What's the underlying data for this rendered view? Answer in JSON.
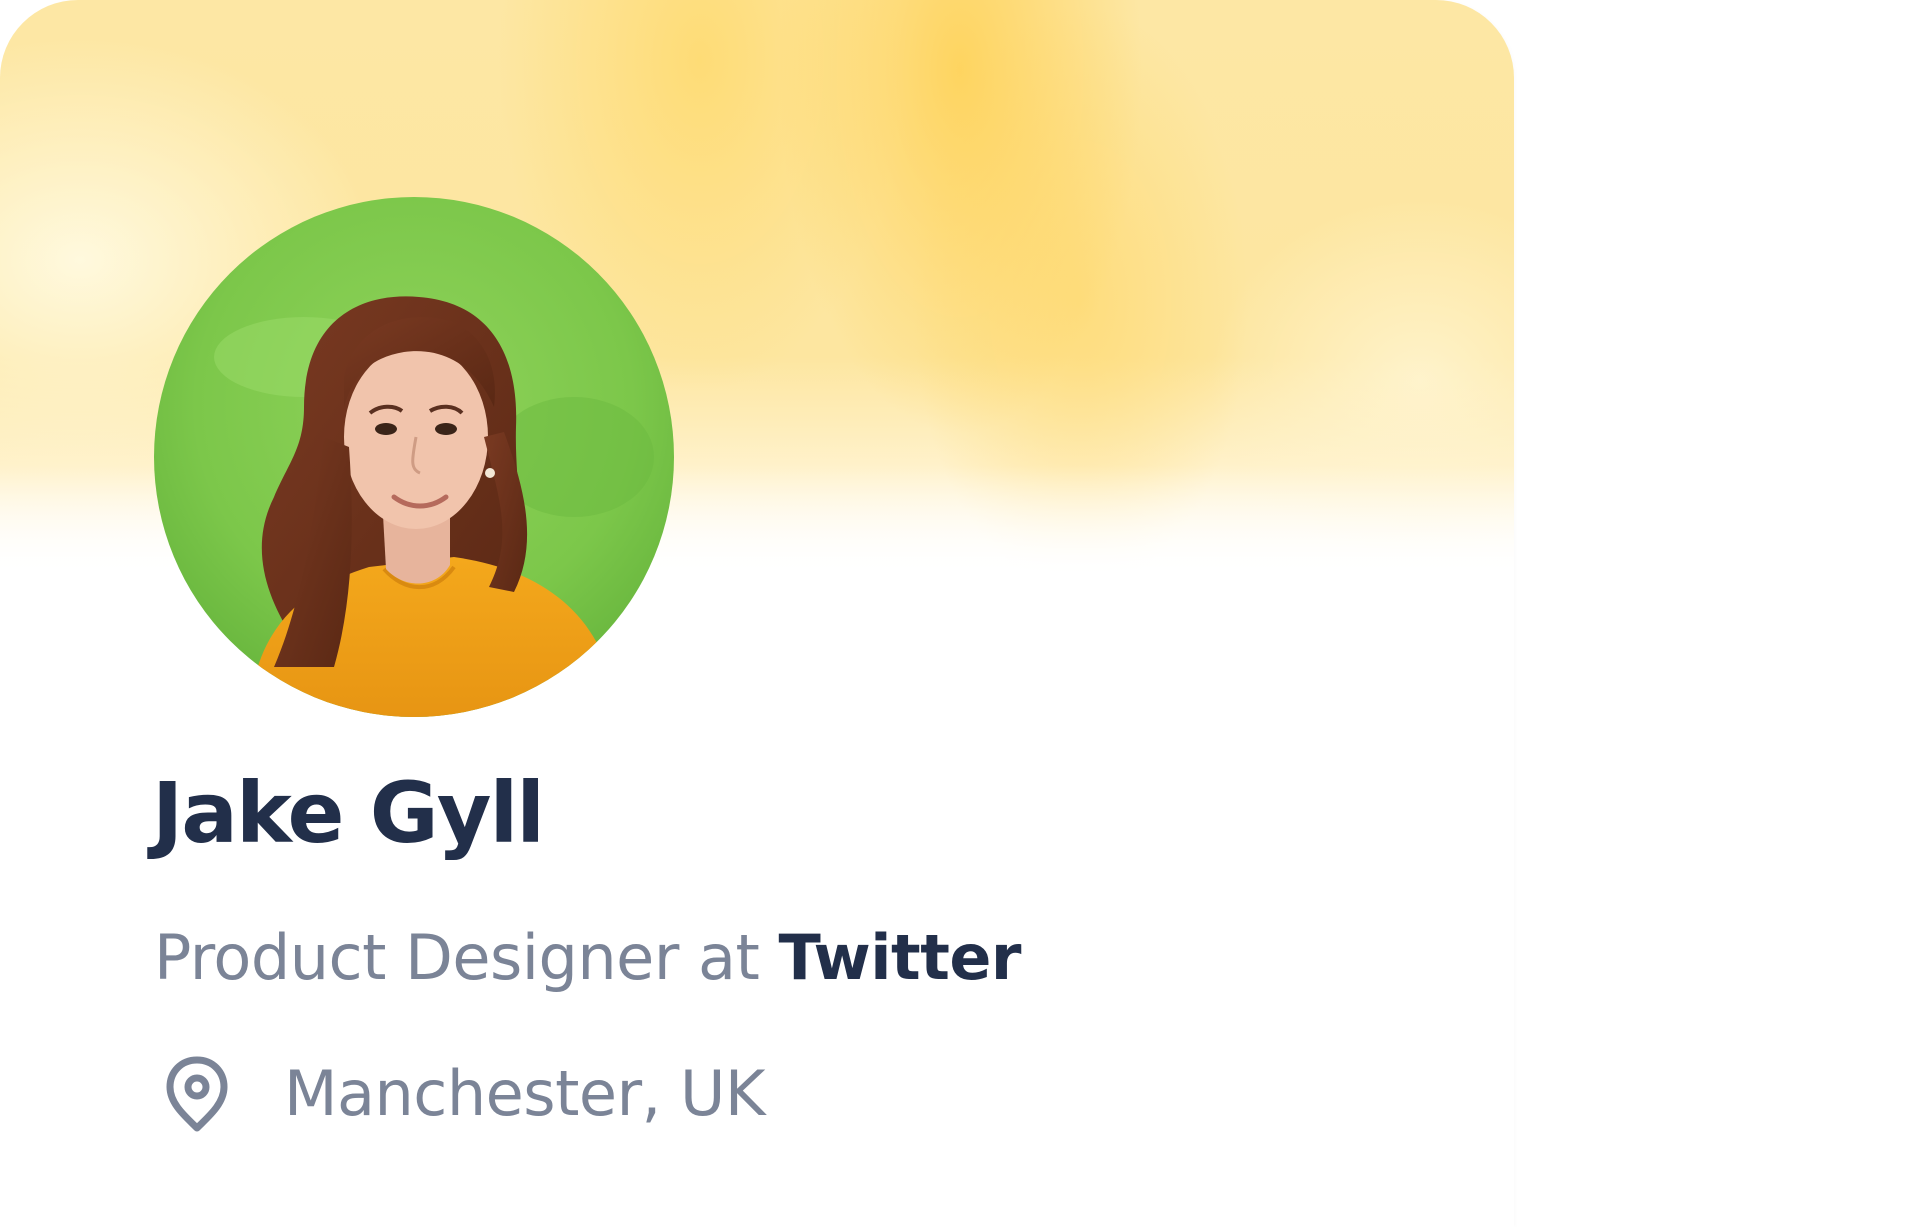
{
  "profile": {
    "name": "Jake Gyll",
    "role_prefix": "Product Designer at",
    "company": "Twitter",
    "location": "Manchester, UK",
    "location_icon": "map-pin-icon"
  },
  "colors": {
    "banner": "#fde7a4",
    "name": "#222f4a",
    "muted": "#7b8497"
  }
}
